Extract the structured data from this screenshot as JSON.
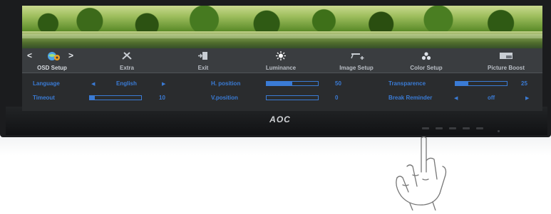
{
  "monitor": {
    "brand": "AOC"
  },
  "osd": {
    "nav_left": "<",
    "nav_right": ">",
    "tabs": [
      {
        "label": "OSD Setup",
        "icon": "globe-gear-icon",
        "active": true
      },
      {
        "label": "Extra",
        "icon": "tools-icon"
      },
      {
        "label": "Exit",
        "icon": "exit-door-icon"
      },
      {
        "label": "Luminance",
        "icon": "sun-icon"
      },
      {
        "label": "Image Setup",
        "icon": "image-plus-icon"
      },
      {
        "label": "Color Setup",
        "icon": "color-dots-icon"
      },
      {
        "label": "Picture Boost",
        "icon": "picture-boost-icon"
      }
    ],
    "settings": {
      "language": {
        "label": "Language",
        "value": "English"
      },
      "timeout": {
        "label": "Timeout",
        "value": "10",
        "level": 0.1
      },
      "h_position": {
        "label": "H. position",
        "value": "50",
        "level": 0.5
      },
      "v_position": {
        "label": "V.position",
        "value": "0",
        "level": 0.0
      },
      "transparence": {
        "label": "Transparence",
        "value": "25",
        "level": 0.25
      },
      "break_reminder": {
        "label": "Break Reminder",
        "value": "off"
      }
    }
  },
  "colors": {
    "accent": "#3a7bd5",
    "menu_bg": "#2a2c2e",
    "tab_bg": "#3a3d40"
  }
}
